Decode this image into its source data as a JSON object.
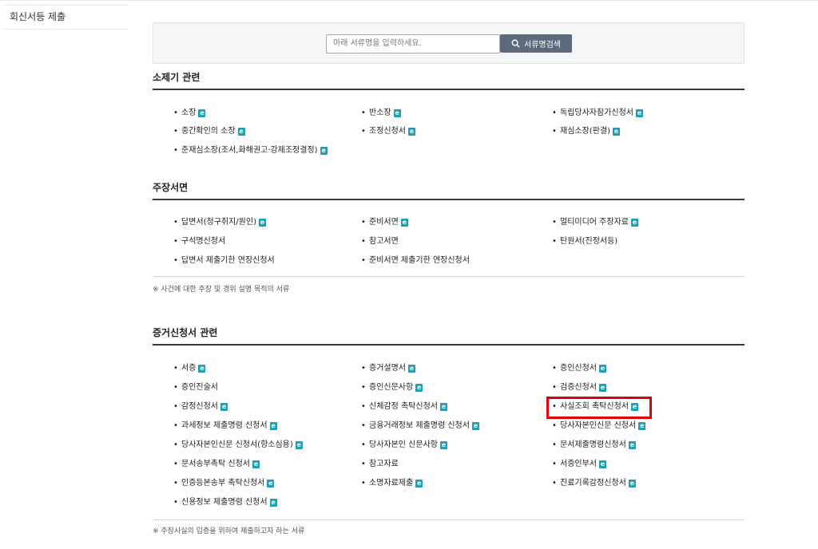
{
  "sidebar": {
    "items": [
      {
        "label": "회신서등 제출"
      }
    ]
  },
  "search": {
    "placeholder": "아래 서류명을 입력하세요.",
    "value": "",
    "button_label": "서류명검색"
  },
  "sections": [
    {
      "title": "소제기 관련",
      "note": "",
      "items": [
        {
          "label": "소장",
          "has_e": true
        },
        {
          "label": "반소장",
          "has_e": true
        },
        {
          "label": "독립당사자참가신청서",
          "has_e": true
        },
        {
          "label": "중간확인의 소장",
          "has_e": true
        },
        {
          "label": "조정신청서",
          "has_e": true
        },
        {
          "label": "재심소장(판결)",
          "has_e": true
        },
        {
          "label": "준재심소장(조서,화해권고·강제조정결정)",
          "has_e": true
        }
      ]
    },
    {
      "title": "주장서면",
      "note": "※ 사건에 대한 주장 및 경위 설명 목적의 서류",
      "items": [
        {
          "label": "답변서(청구취지/원인)",
          "has_e": true
        },
        {
          "label": "준비서면",
          "has_e": true
        },
        {
          "label": "멀티미디어 주장자료",
          "has_e": true
        },
        {
          "label": "구석명신청서",
          "has_e": false
        },
        {
          "label": "참고서면",
          "has_e": false
        },
        {
          "label": "탄원서(진정서등)",
          "has_e": false
        },
        {
          "label": "답변서 제출기한 연장신청서",
          "has_e": false
        },
        {
          "label": "준비서면 제출기한 연장신청서",
          "has_e": false
        }
      ]
    },
    {
      "title": "증거신청서 관련",
      "note": "※ 주장사실의 입증을 위하여 제출하고자 하는 서류",
      "items": [
        {
          "label": "서증",
          "has_e": true
        },
        {
          "label": "증거설명서",
          "has_e": true
        },
        {
          "label": "증인신청서",
          "has_e": true
        },
        {
          "label": "증인진술서",
          "has_e": false
        },
        {
          "label": "증인신문사항",
          "has_e": true
        },
        {
          "label": "검증신청서",
          "has_e": true
        },
        {
          "label": "감정신청서",
          "has_e": true
        },
        {
          "label": "신체감정 촉탁신청서",
          "has_e": true
        },
        {
          "label": "사실조회 촉탁신청서",
          "has_e": true
        },
        {
          "label": "과세정보 제출명령 신청서",
          "has_e": true
        },
        {
          "label": "금융거래정보 제출명령 신청서",
          "has_e": true
        },
        {
          "label": "당사자본인신문 신청서",
          "has_e": true
        },
        {
          "label": "당사자본인신문 신청서(항소심용)",
          "has_e": true
        },
        {
          "label": "당사자본인 신문사항",
          "has_e": true
        },
        {
          "label": "문서제출명령신청서",
          "has_e": true
        },
        {
          "label": "문서송부촉탁 신청서",
          "has_e": true
        },
        {
          "label": "참고자료",
          "has_e": false
        },
        {
          "label": "서증인부서",
          "has_e": true
        },
        {
          "label": "인증등본송부 촉탁신청서",
          "has_e": true
        },
        {
          "label": "소명자료제출",
          "has_e": true
        },
        {
          "label": "진료기록감정신청서",
          "has_e": true
        },
        {
          "label": "신용정보 제출명령 신청서",
          "has_e": true
        }
      ]
    }
  ],
  "icons": {
    "e_doc": "e-document-icon",
    "search": "search-icon"
  },
  "colors": {
    "search_button": "#5d6a7b",
    "e_icon": "#1e9eb0",
    "highlight": "#e00000"
  }
}
